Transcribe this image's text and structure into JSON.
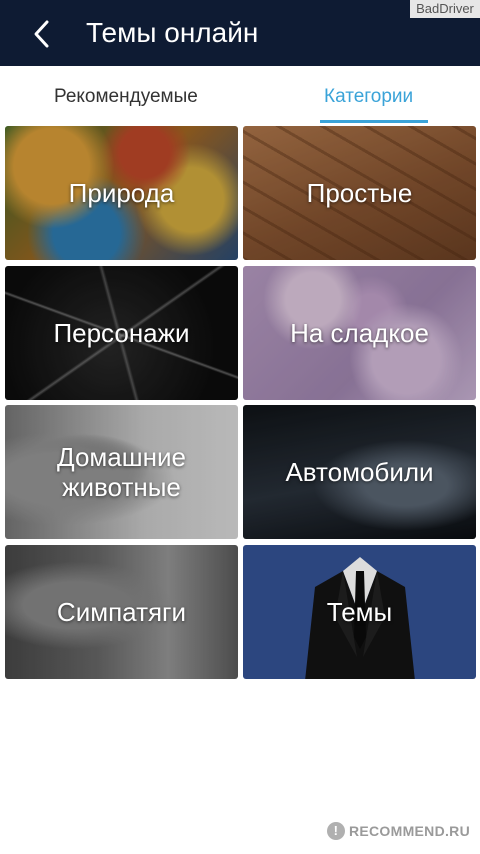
{
  "header": {
    "title": "Темы онлайн",
    "back_icon": "chevron-left-icon",
    "background": "#0e1b33"
  },
  "watermark_top": "BadDriver",
  "tabs": [
    {
      "label": "Рекомендуемые",
      "active": false
    },
    {
      "label": "Категории",
      "active": true
    }
  ],
  "accent_color": "#3aa3d8",
  "categories": [
    {
      "label": "Природа"
    },
    {
      "label": "Простые"
    },
    {
      "label": "Персонажи"
    },
    {
      "label": "На сладкое"
    },
    {
      "label": "Домашние животные"
    },
    {
      "label": "Автомобили"
    },
    {
      "label": "Симпатяги"
    },
    {
      "label": "Темы"
    }
  ],
  "watermark_bottom": {
    "badge": "!",
    "text": "RECOMMEND.RU"
  }
}
